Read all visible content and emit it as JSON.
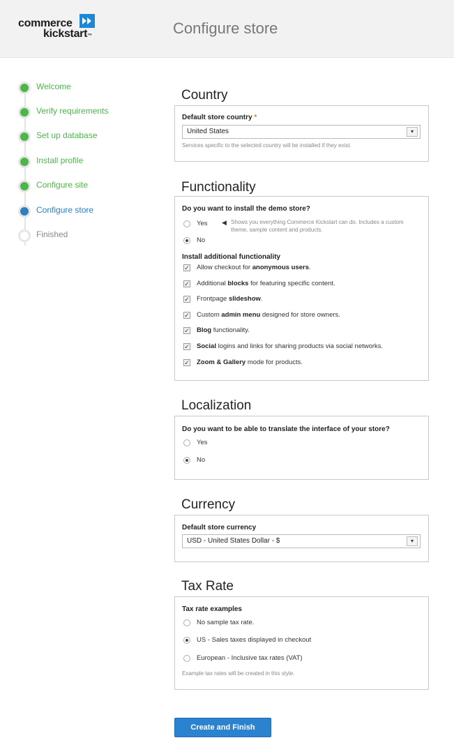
{
  "header": {
    "logo_word1": "commerce",
    "logo_word2": "kickstart",
    "logo_tm": "™",
    "title": "Configure store"
  },
  "steps": [
    {
      "label": "Welcome",
      "state": "done"
    },
    {
      "label": "Verify requirements",
      "state": "done"
    },
    {
      "label": "Set up database",
      "state": "done"
    },
    {
      "label": "Install profile",
      "state": "done"
    },
    {
      "label": "Configure site",
      "state": "done"
    },
    {
      "label": "Configure store",
      "state": "active"
    },
    {
      "label": "Finished",
      "state": "pending"
    }
  ],
  "country": {
    "title": "Country",
    "label": "Default store country",
    "required_mark": "*",
    "value": "United States",
    "help": "Services specific to the selected country will be installed if they exist."
  },
  "functionality": {
    "title": "Functionality",
    "demo_question": "Do you want to install the demo store?",
    "yes": "Yes",
    "no": "No",
    "demo_note": "Shows you everything Commerce Kickstart can do. Includes a custom theme, sample content and products.",
    "demo_selected": "No",
    "additional_label": "Install additional functionality",
    "items": [
      {
        "pre": "Allow checkout for ",
        "bold": "anonymous users",
        "post": ".",
        "checked": true
      },
      {
        "pre": "Additional ",
        "bold": "blocks",
        "post": " for featuring specific content.",
        "checked": true
      },
      {
        "pre": "Frontpage ",
        "bold": "slideshow",
        "post": ".",
        "checked": true
      },
      {
        "pre": "Custom ",
        "bold": "admin menu",
        "post": " designed for store owners.",
        "checked": true
      },
      {
        "pre": "",
        "bold": "Blog",
        "post": " functionality.",
        "checked": true
      },
      {
        "pre": "",
        "bold": "Social",
        "post": " logins and links for sharing products via social networks.",
        "checked": true
      },
      {
        "pre": "",
        "bold": "Zoom & Gallery",
        "post": " mode for products.",
        "checked": true
      }
    ]
  },
  "localization": {
    "title": "Localization",
    "question": "Do you want to be able to translate the interface of your store?",
    "yes": "Yes",
    "no": "No",
    "selected": "No"
  },
  "currency": {
    "title": "Currency",
    "label": "Default store currency",
    "value": "USD - United States Dollar - $"
  },
  "tax": {
    "title": "Tax Rate",
    "label": "Tax rate examples",
    "options": [
      "No sample tax rate.",
      "US - Sales taxes displayed in checkout",
      "European - Inclusive tax rates (VAT)"
    ],
    "selected_index": 1,
    "help": "Example tax rates will be created in this style."
  },
  "submit_label": "Create and Finish",
  "colors": {
    "accent": "#2b82cf",
    "done": "#4cb649",
    "active": "#2c7fc0"
  }
}
